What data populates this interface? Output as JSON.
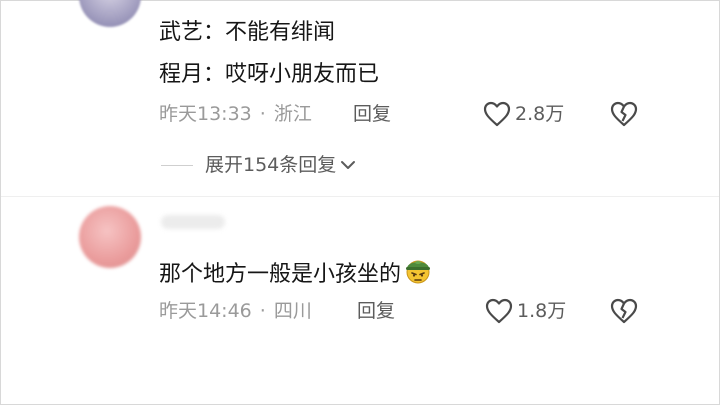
{
  "comment1": {
    "lines": [
      "武艺：不能有绯闻",
      "程月：哎呀小朋友而已"
    ],
    "time": "昨天13:33",
    "location": "浙江",
    "reply_label": "回复",
    "likes": "2.8万"
  },
  "expand_label": "展开154条回复",
  "comment2": {
    "text": "那个地方一般是小孩坐的",
    "emoji": "soldier-face-emoji",
    "time": "昨天14:46",
    "location": "四川",
    "reply_label": "回复",
    "likes": "1.8万"
  },
  "separator": "·",
  "icons": [
    "heart-outline-icon",
    "broken-heart-icon",
    "chevron-down-icon"
  ]
}
